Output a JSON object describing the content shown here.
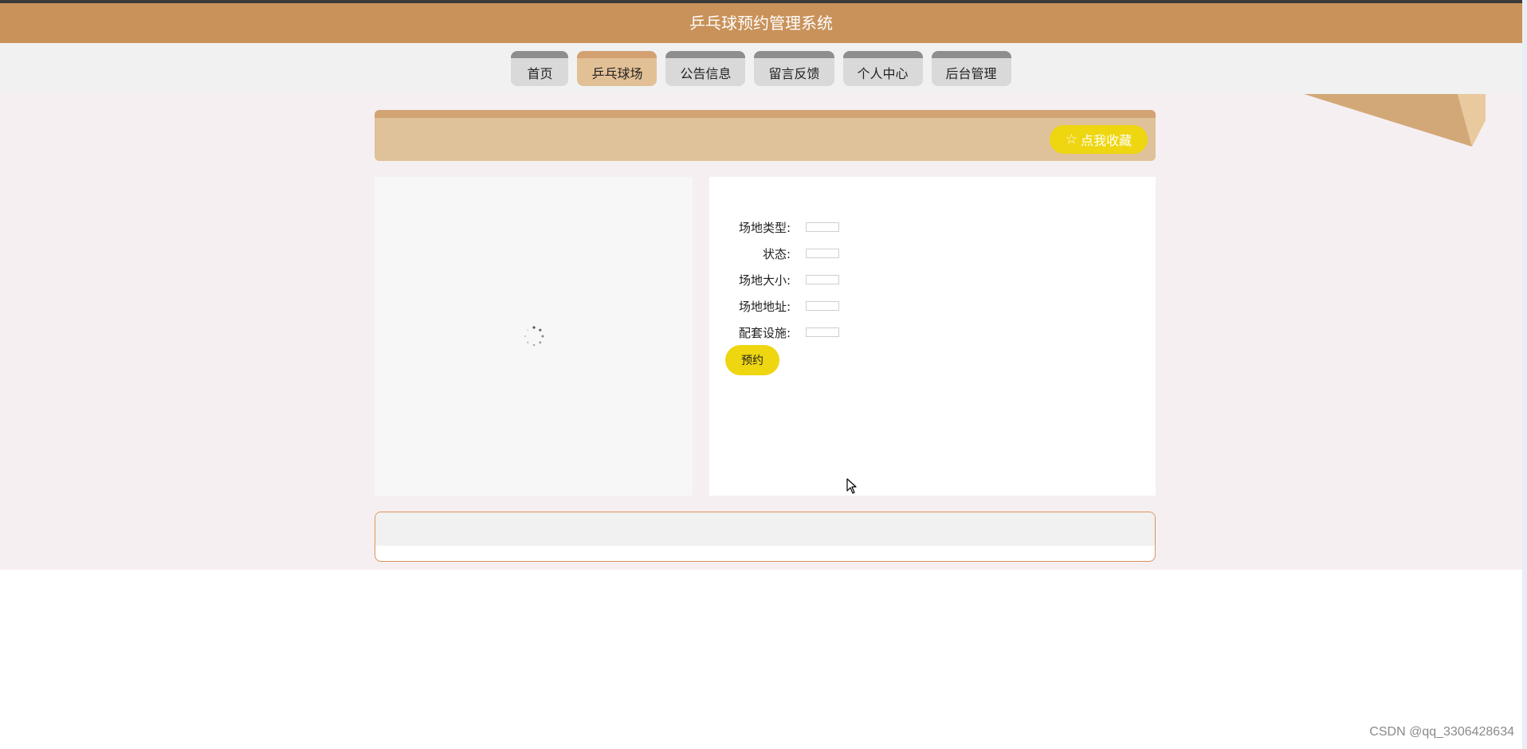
{
  "app": {
    "title": "乒乓球预约管理系统"
  },
  "nav": {
    "items": [
      {
        "label": "首页",
        "active": false
      },
      {
        "label": "乒乓球场",
        "active": true
      },
      {
        "label": "公告信息",
        "active": false
      },
      {
        "label": "留言反馈",
        "active": false
      },
      {
        "label": "个人中心",
        "active": false
      },
      {
        "label": "后台管理",
        "active": false
      }
    ]
  },
  "banner": {
    "favorite_label": "点我收藏",
    "favorite_icon": "star-outline-icon"
  },
  "details": {
    "fields": [
      {
        "label": "场地类型:",
        "value": ""
      },
      {
        "label": "状态:",
        "value": ""
      },
      {
        "label": "场地大小:",
        "value": ""
      },
      {
        "label": "场地地址:",
        "value": ""
      },
      {
        "label": "配套设施:",
        "value": ""
      }
    ],
    "reserve_label": "预约"
  },
  "image": {
    "icon": "loading-spinner-icon"
  },
  "watermark": "CSDN @qq_3306428634",
  "colors": {
    "header": "#c9925a",
    "nav_tab": "#d9d9d9",
    "nav_tab_active": "#e2c096",
    "banner": "#dfc29a",
    "accent_button": "#eed610",
    "page_bg": "#f6eff2",
    "comment_border": "#d7935a"
  }
}
